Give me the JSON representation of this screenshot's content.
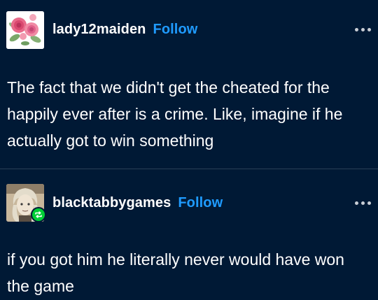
{
  "posts": [
    {
      "username": "lady12maiden",
      "follow_label": "Follow",
      "text": "The fact that we didn't get the cheated for the happily ever after is a crime. Like, imagine if he actually got to win something",
      "avatar_icon": "roses-avatar-icon"
    },
    {
      "username": "blacktabbygames",
      "follow_label": "Follow",
      "text": "if you got him he literally never would have won the game",
      "avatar_icon": "character-avatar-icon",
      "badge_icon": "reblog-icon"
    }
  ],
  "colors": {
    "background": "#001935",
    "follow": "#1f9bff",
    "reblog_badge": "#00cf35",
    "text": "#ffffff"
  }
}
